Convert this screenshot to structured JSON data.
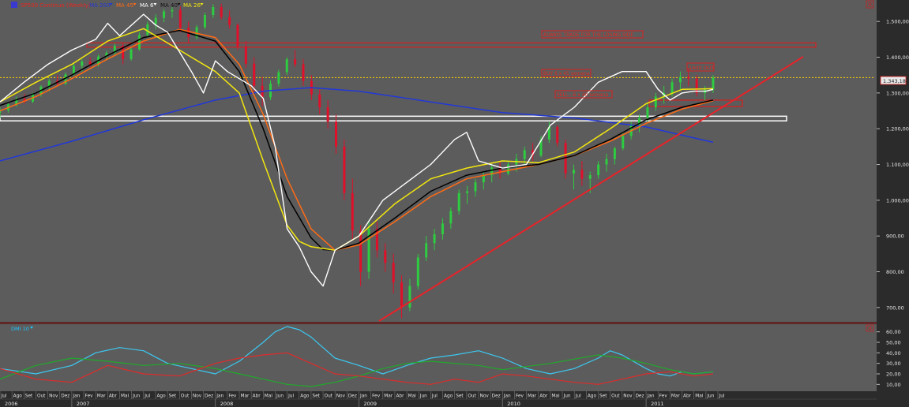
{
  "colors": {
    "background": "#5c5c5c",
    "panel_frame": "#2b2b2b",
    "axis_text": "#e6e6e6",
    "candle_up": "#2ecc40",
    "candle_down": "#e0102a",
    "ma200": "#2238d8",
    "ma45": "#ff6a14",
    "ma6": "#ffffff",
    "ma40": "#000000",
    "ma26": "#f2e60f",
    "trendline": "#e8232a",
    "yellow_level": "#ffd400",
    "white_box": "#ffffff",
    "red_box": "#d81f1f",
    "annotation_text": "#e6281e",
    "dmi_label": "#20c4ff",
    "dmi_adx": "#3cc8f0",
    "dmi_plus": "#1faa2a",
    "dmi_minus": "#e02b2b"
  },
  "header": {
    "symbol": "SP500 Continuo (Weekly)",
    "indicators": [
      {
        "label": "MA 200",
        "color": "#2238d8"
      },
      {
        "label": "MA 45",
        "color": "#ff6a14"
      },
      {
        "label": "MA 6",
        "color": "#ffffff"
      },
      {
        "label": "MA 40",
        "color": "#000000"
      },
      {
        "label": "MA 26",
        "color": "#f2e60f"
      }
    ]
  },
  "annotations": {
    "losing_side": "ALWAYS TRADE FOR THE LOSING SIDE",
    "buy": "BUY 6 x 45 semana",
    "sell": "SELL---6 x 40 semana",
    "out": "1400 OUT",
    "last_price": "1.343,18"
  },
  "price_axis": {
    "ticks": [
      "1.500,00",
      "1.400,00",
      "1.300,00",
      "1.200,00",
      "1.100,00",
      "1.000,00",
      "900,00",
      "800,00",
      "700,00"
    ]
  },
  "dmi_panel": {
    "label": "DMI 10",
    "ticks": [
      "60,00",
      "50,00",
      "40,00",
      "30,00",
      "20,00",
      "10,00"
    ]
  },
  "time_axis": {
    "months": [
      "Jul",
      "Ago",
      "Set",
      "Out",
      "Nov",
      "Dez",
      "Jan",
      "Fev",
      "Mar",
      "Abr",
      "Mai",
      "Jun",
      "Jul",
      "Ago",
      "Set",
      "Out",
      "Nov",
      "Dez",
      "Jan",
      "Fev",
      "Mar",
      "Abr",
      "Mai",
      "Jun",
      "Jul",
      "Ago",
      "Set",
      "Out",
      "Nov",
      "Dez",
      "Jan",
      "Fev",
      "Mar",
      "Abr",
      "Mai",
      "Jun",
      "Jul",
      "Ago",
      "Set",
      "Out",
      "Nov",
      "Dez",
      "Jan",
      "Fev",
      "Mar",
      "Abr",
      "Mai",
      "Jun",
      "Jul",
      "Ago",
      "Set",
      "Out",
      "Nov",
      "Dez",
      "Jan",
      "Fev",
      "Mar",
      "Abr",
      "Mai",
      "Jun",
      "Jul"
    ],
    "years": [
      "2006",
      "2007",
      "2008",
      "2009",
      "2010",
      "2011"
    ]
  },
  "chart_data": {
    "type": "candlestick",
    "title": "SP500 Continuo (Weekly)",
    "x_unit": "month",
    "x_start": "Jul 2006",
    "ylim": [
      660,
      1560
    ],
    "series": [
      {
        "name": "MA 200",
        "x": [
          0,
          6,
          12,
          18,
          22,
          26,
          30,
          36,
          42,
          48,
          54,
          59.6
        ],
        "values": [
          1110,
          1165,
          1225,
          1280,
          1305,
          1315,
          1305,
          1275,
          1245,
          1230,
          1205,
          1162
        ]
      },
      {
        "name": "MA 45",
        "x": [
          0,
          3,
          6,
          9,
          12,
          15,
          18,
          20,
          22,
          24,
          26,
          28,
          30,
          33,
          36,
          39,
          42,
          45,
          48,
          51,
          54,
          57,
          59.6
        ],
        "values": [
          1250,
          1290,
          1340,
          1395,
          1445,
          1478,
          1455,
          1380,
          1240,
          1060,
          920,
          860,
          875,
          940,
          1010,
          1060,
          1080,
          1100,
          1125,
          1165,
          1215,
          1255,
          1278
        ]
      },
      {
        "name": "MA 40",
        "x": [
          0,
          3,
          6,
          9,
          12,
          15,
          18,
          20,
          22,
          24,
          26,
          27,
          28,
          30,
          33,
          36,
          39,
          42,
          45,
          48,
          51,
          54,
          57,
          59.6
        ],
        "values": [
          1265,
          1300,
          1350,
          1405,
          1455,
          1475,
          1445,
          1360,
          1200,
          1010,
          895,
          862,
          860,
          880,
          950,
          1025,
          1070,
          1090,
          1100,
          1125,
          1170,
          1225,
          1260,
          1280
        ]
      },
      {
        "name": "MA 26",
        "x": [
          0,
          3,
          6,
          9,
          12,
          15,
          18,
          20,
          22,
          24,
          25,
          26,
          28,
          30,
          33,
          36,
          39,
          42,
          45,
          48,
          51,
          54,
          57,
          59.6
        ],
        "values": [
          1275,
          1330,
          1380,
          1445,
          1480,
          1420,
          1360,
          1300,
          1110,
          930,
          885,
          870,
          860,
          900,
          990,
          1060,
          1090,
          1110,
          1105,
          1135,
          1200,
          1270,
          1310,
          1312
        ]
      },
      {
        "name": "MA 6",
        "x": [
          0,
          2,
          4,
          6,
          8,
          9,
          10,
          12,
          13,
          14,
          16,
          17,
          18,
          19,
          20,
          21,
          22,
          23,
          24,
          25,
          26,
          27,
          28,
          30,
          32,
          34,
          36,
          38,
          39,
          40,
          42,
          44,
          46,
          48,
          50,
          52,
          54,
          55,
          56,
          57,
          58,
          59,
          59.6
        ],
        "values": [
          1275,
          1330,
          1380,
          1420,
          1450,
          1495,
          1460,
          1520,
          1490,
          1470,
          1360,
          1300,
          1390,
          1360,
          1340,
          1320,
          1285,
          1150,
          920,
          870,
          800,
          760,
          860,
          900,
          1000,
          1050,
          1100,
          1170,
          1190,
          1110,
          1090,
          1100,
          1210,
          1260,
          1330,
          1360,
          1360,
          1310,
          1280,
          1300,
          1305,
          1305,
          1310
        ]
      }
    ],
    "candles_ohlc": [
      [
        1245,
        1260,
        1230,
        1252
      ],
      [
        1252,
        1275,
        1245,
        1268
      ],
      [
        1268,
        1290,
        1262,
        1284
      ],
      [
        1284,
        1298,
        1270,
        1276
      ],
      [
        1276,
        1300,
        1272,
        1296
      ],
      [
        1296,
        1322,
        1290,
        1318
      ],
      [
        1318,
        1340,
        1305,
        1334
      ],
      [
        1334,
        1350,
        1320,
        1326
      ],
      [
        1326,
        1358,
        1322,
        1352
      ],
      [
        1352,
        1382,
        1348,
        1376
      ],
      [
        1376,
        1395,
        1360,
        1388
      ],
      [
        1388,
        1400,
        1372,
        1380
      ],
      [
        1380,
        1408,
        1374,
        1402
      ],
      [
        1402,
        1418,
        1392,
        1412
      ],
      [
        1412,
        1438,
        1405,
        1432
      ],
      [
        1432,
        1440,
        1380,
        1395
      ],
      [
        1395,
        1428,
        1390,
        1422
      ],
      [
        1422,
        1470,
        1418,
        1462
      ],
      [
        1462,
        1500,
        1455,
        1492
      ],
      [
        1492,
        1520,
        1478,
        1510
      ],
      [
        1510,
        1535,
        1498,
        1528
      ],
      [
        1528,
        1540,
        1510,
        1532
      ],
      [
        1532,
        1542,
        1470,
        1482
      ],
      [
        1482,
        1500,
        1440,
        1456
      ],
      [
        1456,
        1490,
        1450,
        1484
      ],
      [
        1484,
        1525,
        1478,
        1518
      ],
      [
        1518,
        1548,
        1510,
        1540
      ],
      [
        1540,
        1550,
        1505,
        1512
      ],
      [
        1512,
        1530,
        1480,
        1490
      ],
      [
        1490,
        1495,
        1420,
        1430
      ],
      [
        1430,
        1445,
        1370,
        1382
      ],
      [
        1382,
        1400,
        1300,
        1320
      ],
      [
        1320,
        1345,
        1262,
        1288
      ],
      [
        1288,
        1335,
        1280,
        1326
      ],
      [
        1326,
        1365,
        1318,
        1358
      ],
      [
        1358,
        1400,
        1350,
        1394
      ],
      [
        1394,
        1420,
        1372,
        1380
      ],
      [
        1380,
        1395,
        1320,
        1334
      ],
      [
        1334,
        1350,
        1280,
        1296
      ],
      [
        1296,
        1310,
        1240,
        1260
      ],
      [
        1260,
        1280,
        1200,
        1220
      ],
      [
        1220,
        1240,
        1130,
        1150
      ],
      [
        1150,
        1170,
        1000,
        1020
      ],
      [
        1020,
        1060,
        890,
        915
      ],
      [
        915,
        930,
        760,
        800
      ],
      [
        800,
        945,
        780,
        920
      ],
      [
        920,
        940,
        840,
        860
      ],
      [
        860,
        880,
        800,
        825
      ],
      [
        825,
        850,
        740,
        770
      ],
      [
        770,
        790,
        670,
        700
      ],
      [
        700,
        780,
        690,
        760
      ],
      [
        760,
        850,
        750,
        840
      ],
      [
        840,
        900,
        830,
        880
      ],
      [
        880,
        920,
        860,
        905
      ],
      [
        905,
        950,
        890,
        935
      ],
      [
        935,
        980,
        920,
        970
      ],
      [
        970,
        1030,
        960,
        1020
      ],
      [
        1020,
        1040,
        990,
        1025
      ],
      [
        1025,
        1060,
        1010,
        1050
      ],
      [
        1050,
        1080,
        1030,
        1070
      ],
      [
        1070,
        1100,
        1050,
        1092
      ],
      [
        1092,
        1110,
        1060,
        1075
      ],
      [
        1075,
        1110,
        1070,
        1100
      ],
      [
        1100,
        1130,
        1080,
        1115
      ],
      [
        1115,
        1150,
        1100,
        1140
      ],
      [
        1140,
        1160,
        1110,
        1125
      ],
      [
        1125,
        1180,
        1120,
        1170
      ],
      [
        1170,
        1220,
        1160,
        1205
      ],
      [
        1205,
        1210,
        1150,
        1160
      ],
      [
        1160,
        1170,
        1060,
        1075
      ],
      [
        1075,
        1100,
        1030,
        1085
      ],
      [
        1085,
        1110,
        1040,
        1060
      ],
      [
        1060,
        1080,
        1020,
        1070
      ],
      [
        1070,
        1110,
        1060,
        1100
      ],
      [
        1100,
        1130,
        1080,
        1115
      ],
      [
        1115,
        1150,
        1100,
        1145
      ],
      [
        1145,
        1190,
        1140,
        1180
      ],
      [
        1180,
        1220,
        1170,
        1210
      ],
      [
        1210,
        1240,
        1190,
        1230
      ],
      [
        1230,
        1270,
        1220,
        1260
      ],
      [
        1260,
        1300,
        1250,
        1290
      ],
      [
        1290,
        1320,
        1270,
        1300
      ],
      [
        1300,
        1340,
        1290,
        1330
      ],
      [
        1330,
        1360,
        1310,
        1345
      ],
      [
        1345,
        1370,
        1320,
        1340
      ],
      [
        1340,
        1350,
        1290,
        1300
      ],
      [
        1300,
        1320,
        1280,
        1310
      ],
      [
        1310,
        1350,
        1300,
        1343
      ]
    ],
    "dmi": {
      "label": "DMI 10",
      "ylim": [
        5,
        65
      ],
      "adx": {
        "name": "ADX",
        "x": [
          0,
          3,
          6,
          8,
          10,
          12,
          14,
          16,
          18,
          20,
          22,
          23,
          24,
          25,
          26,
          27,
          28,
          30,
          32,
          34,
          36,
          38,
          40,
          42,
          44,
          46,
          48,
          50,
          51,
          52,
          54,
          55,
          56,
          57,
          58,
          59.6
        ],
        "values": [
          25,
          20,
          28,
          40,
          45,
          42,
          30,
          25,
          20,
          32,
          50,
          60,
          65,
          62,
          55,
          45,
          35,
          28,
          20,
          28,
          35,
          38,
          42,
          35,
          25,
          20,
          25,
          35,
          42,
          38,
          25,
          20,
          18,
          22,
          20,
          22
        ]
      },
      "plus_di": {
        "name": "+DI",
        "x": [
          0,
          3,
          6,
          9,
          12,
          15,
          18,
          20,
          22,
          24,
          26,
          28,
          30,
          32,
          34,
          36,
          38,
          40,
          42,
          44,
          46,
          48,
          50,
          52,
          54,
          56,
          58,
          59.6
        ],
        "values": [
          15,
          28,
          35,
          32,
          28,
          30,
          25,
          20,
          15,
          10,
          8,
          12,
          18,
          25,
          30,
          32,
          30,
          28,
          24,
          27,
          30,
          34,
          38,
          35,
          30,
          24,
          20,
          22
        ]
      },
      "minus_di": {
        "name": "-DI",
        "x": [
          0,
          3,
          6,
          9,
          12,
          15,
          18,
          20,
          22,
          24,
          26,
          28,
          30,
          32,
          34,
          36,
          38,
          40,
          42,
          44,
          46,
          48,
          50,
          52,
          54,
          56,
          58,
          59.6
        ],
        "values": [
          25,
          15,
          12,
          28,
          20,
          18,
          30,
          35,
          38,
          40,
          30,
          20,
          18,
          15,
          12,
          10,
          15,
          12,
          20,
          18,
          15,
          12,
          10,
          15,
          20,
          22,
          18,
          20
        ]
      }
    }
  }
}
